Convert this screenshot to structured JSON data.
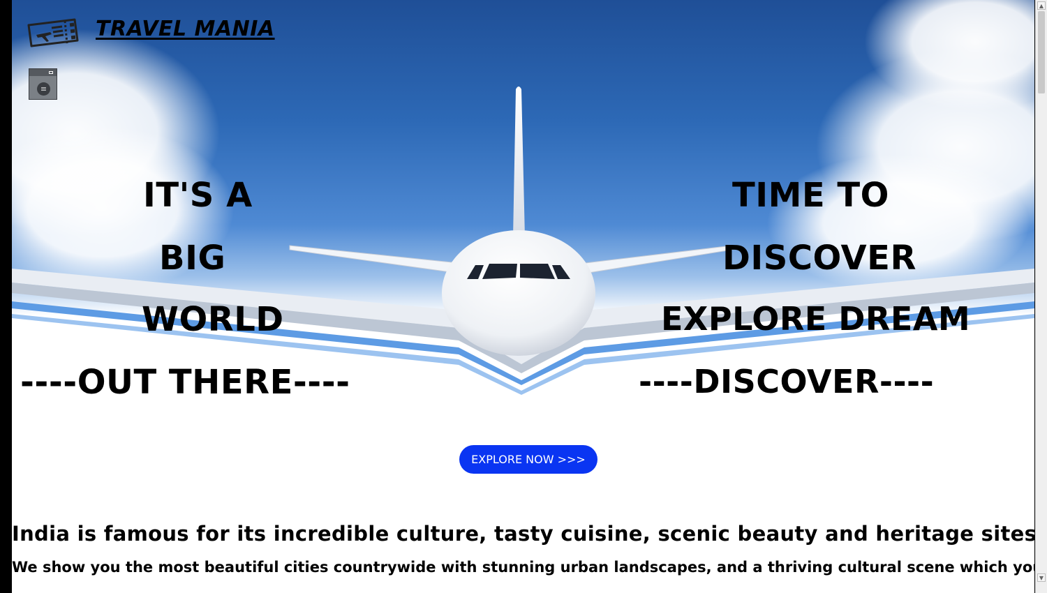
{
  "header": {
    "brand": "TRAVEL MANIA",
    "logo_icon": "plane-ticket-icon",
    "menu_icon": "menu-icon",
    "menu_glyph": "≡"
  },
  "hero": {
    "left_lines": [
      "IT'S A",
      "BIG",
      "WORLD",
      "----OUT THERE----"
    ],
    "right_lines": [
      "TIME TO",
      "DISCOVER",
      "EXPLORE DREAM",
      "----DISCOVER----"
    ]
  },
  "cta": {
    "label": "EXPLORE NOW >>>"
  },
  "taglines": {
    "primary": "India is famous for its incredible culture, tasty cuisine, scenic beauty and heritage sites.",
    "secondary": "We show you the most beautiful cities countrywide with stunning urban landscapes, and a thriving cultural scene which you should visit."
  },
  "scrollbar": {
    "up_arrow": "▲",
    "down_arrow": "▼"
  },
  "colors": {
    "cta_bg": "#0a35f2",
    "sky_top": "#1f4f97",
    "sky_mid": "#4f8ad4",
    "text": "#000000"
  }
}
